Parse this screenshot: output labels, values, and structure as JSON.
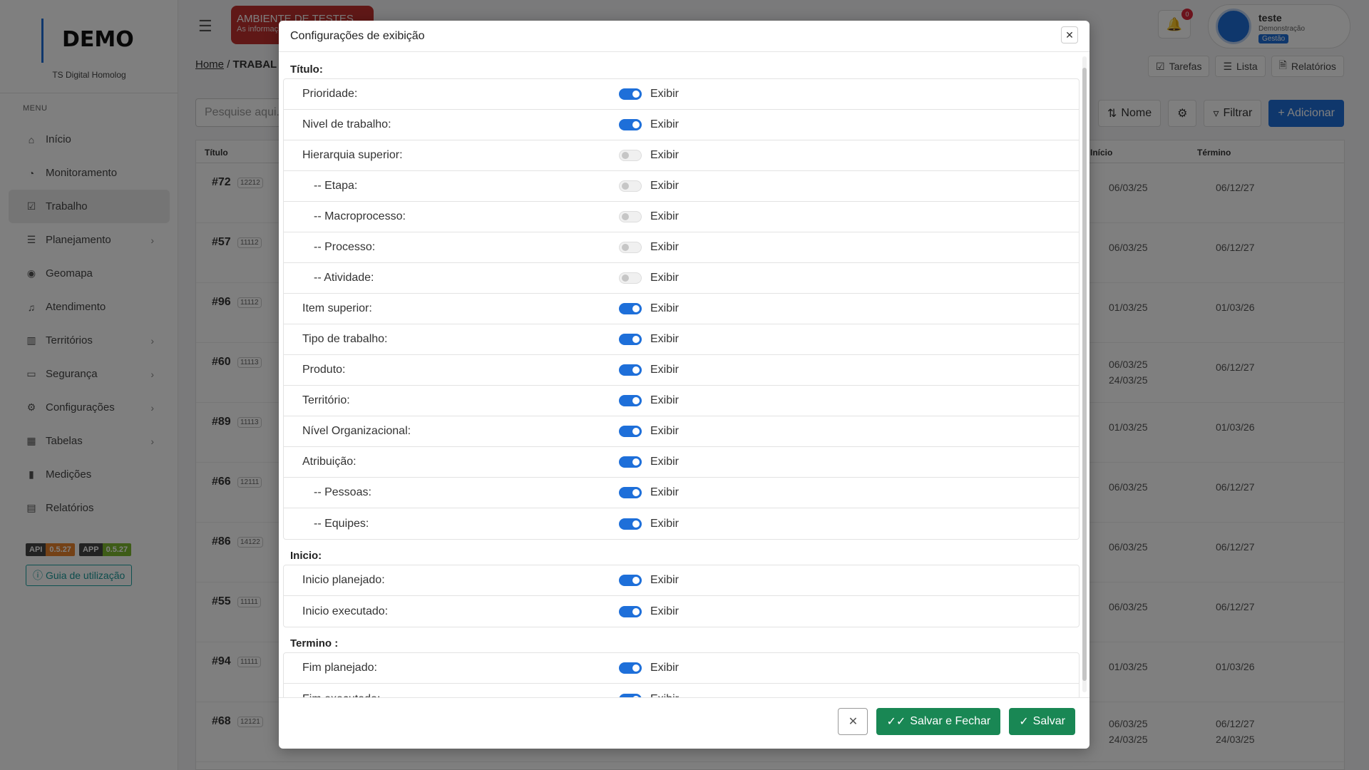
{
  "sidebar": {
    "logo": "DEMO",
    "subtitle": "TS Digital Homolog",
    "menu_label": "MENU",
    "items": [
      {
        "label": "Início",
        "icon": "home-icon",
        "chevron": false
      },
      {
        "label": "Monitoramento",
        "icon": "gauge-icon",
        "chevron": false
      },
      {
        "label": "Trabalho",
        "icon": "checkbox-icon",
        "chevron": false,
        "active": true
      },
      {
        "label": "Planejamento",
        "icon": "list-plan-icon",
        "chevron": true
      },
      {
        "label": "Geomapa",
        "icon": "map-pin-icon",
        "chevron": false
      },
      {
        "label": "Atendimento",
        "icon": "headset-icon",
        "chevron": false
      },
      {
        "label": "Territórios",
        "icon": "map-icon",
        "chevron": true
      },
      {
        "label": "Segurança",
        "icon": "folder-lock-icon",
        "chevron": true
      },
      {
        "label": "Configurações",
        "icon": "gear-icon",
        "chevron": true
      },
      {
        "label": "Tabelas",
        "icon": "table-icon",
        "chevron": true
      },
      {
        "label": "Medições",
        "icon": "bar-chart-icon",
        "chevron": false
      },
      {
        "label": "Relatórios",
        "icon": "report-icon",
        "chevron": false
      }
    ],
    "api_label": "API",
    "api_version": "0.5.27",
    "app_label": "APP",
    "app_version": "0.5.27",
    "guide": "Guia de utilização"
  },
  "header": {
    "env_title": "AMBIENTE DE TESTES",
    "env_sub": "As informaç",
    "notifications": "0",
    "user_name": "teste",
    "user_role": "Demonstração",
    "user_badge": "Gestão"
  },
  "breadcrumb": {
    "home": "Home",
    "sep": "/",
    "current": "TRABAL"
  },
  "view_buttons": [
    "Tarefas",
    "Lista",
    "Relatórios"
  ],
  "search": {
    "placeholder": "Pesquise aqui..."
  },
  "tools": {
    "sort": "Nome",
    "filter": "Filtrar",
    "add": "+ Adicionar"
  },
  "table": {
    "col_title": "Título",
    "col_start": "Início",
    "col_end": "Término",
    "rows": [
      {
        "num": "#72",
        "code": "12212",
        "start": "06/03/25",
        "start2": "",
        "end": "06/12/27",
        "end2": ""
      },
      {
        "num": "#57",
        "code": "11112",
        "start": "06/03/25",
        "start2": "",
        "end": "06/12/27",
        "end2": ""
      },
      {
        "num": "#96",
        "code": "11112",
        "start": "01/03/25",
        "start2": "",
        "end": "01/03/26",
        "end2": ""
      },
      {
        "num": "#60",
        "code": "11113",
        "start": "06/03/25",
        "start2": "24/03/25",
        "end": "06/12/27",
        "end2": ""
      },
      {
        "num": "#89",
        "code": "11113",
        "start": "01/03/25",
        "start2": "",
        "end": "01/03/26",
        "end2": ""
      },
      {
        "num": "#66",
        "code": "12111",
        "start": "06/03/25",
        "start2": "",
        "end": "06/12/27",
        "end2": ""
      },
      {
        "num": "#86",
        "code": "14122",
        "start": "06/03/25",
        "start2": "",
        "end": "06/12/27",
        "end2": ""
      },
      {
        "num": "#55",
        "code": "11111",
        "start": "06/03/25",
        "start2": "",
        "end": "06/12/27",
        "end2": ""
      },
      {
        "num": "#94",
        "code": "11111",
        "start": "01/03/25",
        "start2": "",
        "end": "01/03/26",
        "end2": ""
      },
      {
        "num": "#68",
        "code": "12121",
        "start": "06/03/25",
        "start2": "24/03/25",
        "end": "06/12/27",
        "end2": "24/03/25"
      }
    ]
  },
  "modal": {
    "title": "Configurações de exibição",
    "switch_label": "Exibir",
    "sections": [
      {
        "title": "Título:",
        "rows": [
          {
            "label": "Prioridade:",
            "on": true,
            "sub": false
          },
          {
            "label": "Nivel de trabalho:",
            "on": true,
            "sub": false
          },
          {
            "label": "Hierarquia superior:",
            "on": false,
            "sub": false
          },
          {
            "label": "-- Etapa:",
            "on": false,
            "sub": true
          },
          {
            "label": "-- Macroprocesso:",
            "on": false,
            "sub": true
          },
          {
            "label": "-- Processo:",
            "on": false,
            "sub": true
          },
          {
            "label": "-- Atividade:",
            "on": false,
            "sub": true
          },
          {
            "label": "Item superior:",
            "on": true,
            "sub": false
          },
          {
            "label": "Tipo de trabalho:",
            "on": true,
            "sub": false
          },
          {
            "label": "Produto:",
            "on": true,
            "sub": false
          },
          {
            "label": "Território:",
            "on": true,
            "sub": false
          },
          {
            "label": "Nível Organizacional:",
            "on": true,
            "sub": false
          },
          {
            "label": "Atribuição:",
            "on": true,
            "sub": false
          },
          {
            "label": "-- Pessoas:",
            "on": true,
            "sub": true
          },
          {
            "label": "-- Equipes:",
            "on": true,
            "sub": true
          }
        ]
      },
      {
        "title": "Inicio:",
        "rows": [
          {
            "label": "Inicio planejado:",
            "on": true,
            "sub": false
          },
          {
            "label": "Inicio executado:",
            "on": true,
            "sub": false
          }
        ]
      },
      {
        "title": "Termino :",
        "rows": [
          {
            "label": "Fim planejado:",
            "on": true,
            "sub": false
          },
          {
            "label": "Fim executado:",
            "on": true,
            "sub": false
          }
        ]
      }
    ],
    "save_close": "Salvar e Fechar",
    "save": "Salvar"
  }
}
